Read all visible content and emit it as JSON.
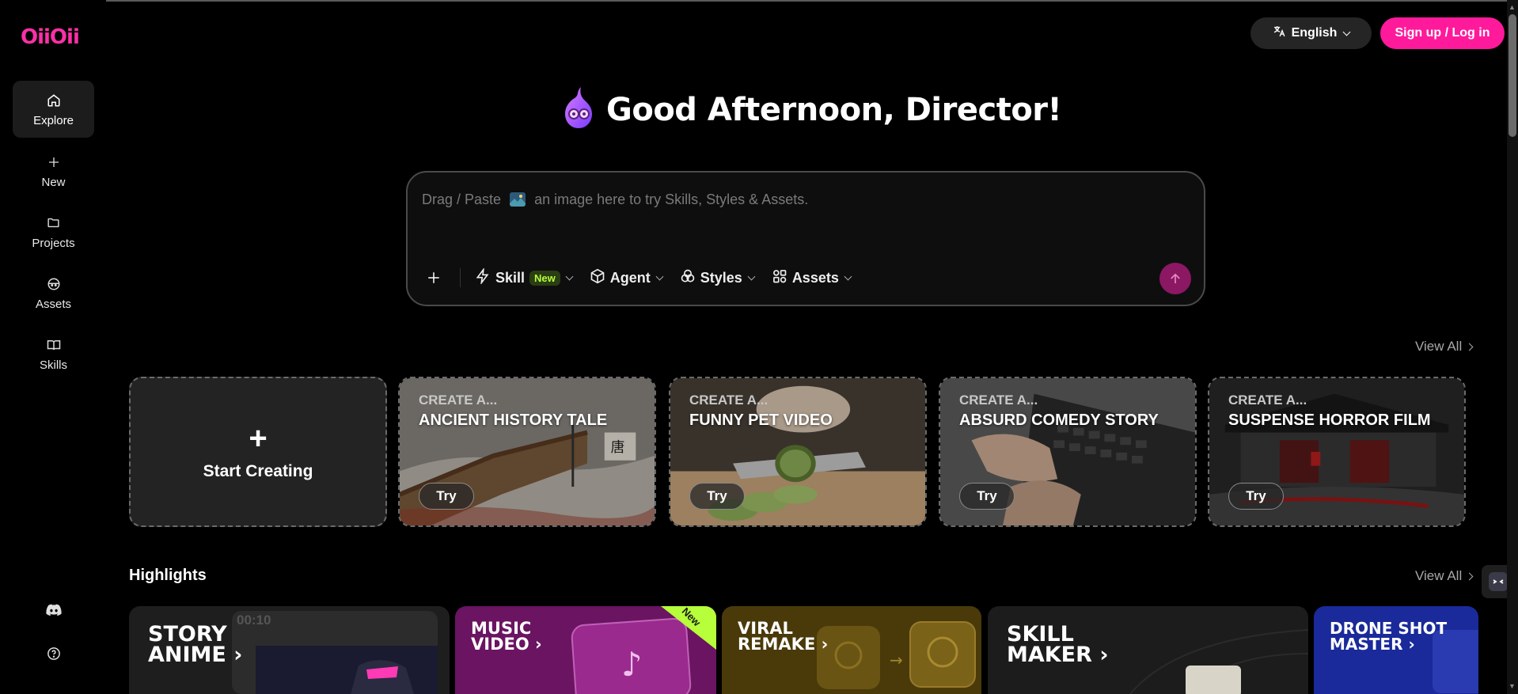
{
  "logo": "OiiOii",
  "nav": {
    "explore": "Explore",
    "new": "New",
    "projects": "Projects",
    "assets": "Assets",
    "skills": "Skills"
  },
  "header": {
    "language": "English",
    "signup": "Sign up / Log in"
  },
  "greeting": "Good Afternoon, Director!",
  "prompt": {
    "placeholder_before": "Drag / Paste",
    "placeholder_after": "an image here to try Skills, Styles & Assets.",
    "skill": "Skill",
    "new_badge": "New",
    "agent": "Agent",
    "styles": "Styles",
    "assets": "Assets"
  },
  "templates": {
    "view_all": "View All",
    "start": "Start Creating",
    "cards": [
      {
        "prefix": "CREATE A...",
        "title": "ANCIENT HISTORY TALE",
        "try": "Try"
      },
      {
        "prefix": "CREATE A...",
        "title": "FUNNY PET VIDEO",
        "try": "Try"
      },
      {
        "prefix": "CREATE A...",
        "title": "ABSURD COMEDY STORY",
        "try": "Try"
      },
      {
        "prefix": "CREATE A...",
        "title": "SUSPENSE HORROR FILM",
        "try": "Try"
      }
    ]
  },
  "highlights": {
    "title": "Highlights",
    "view_all": "View All",
    "items": [
      {
        "line1": "STORY",
        "line2": "ANIME",
        "timer": "00:10"
      },
      {
        "line1": "MUSIC",
        "line2": "VIDEO",
        "badge": "New"
      },
      {
        "line1": "VIRAL",
        "line2": "REMAKE"
      },
      {
        "line1": "SKILL",
        "line2": "MAKER"
      },
      {
        "line1": "DRONE SHOT",
        "line2": "MASTER"
      }
    ]
  },
  "colors": {
    "brand": "#ff1a9c",
    "send": "#8c1763",
    "new_badge": "#b6ff3a"
  }
}
